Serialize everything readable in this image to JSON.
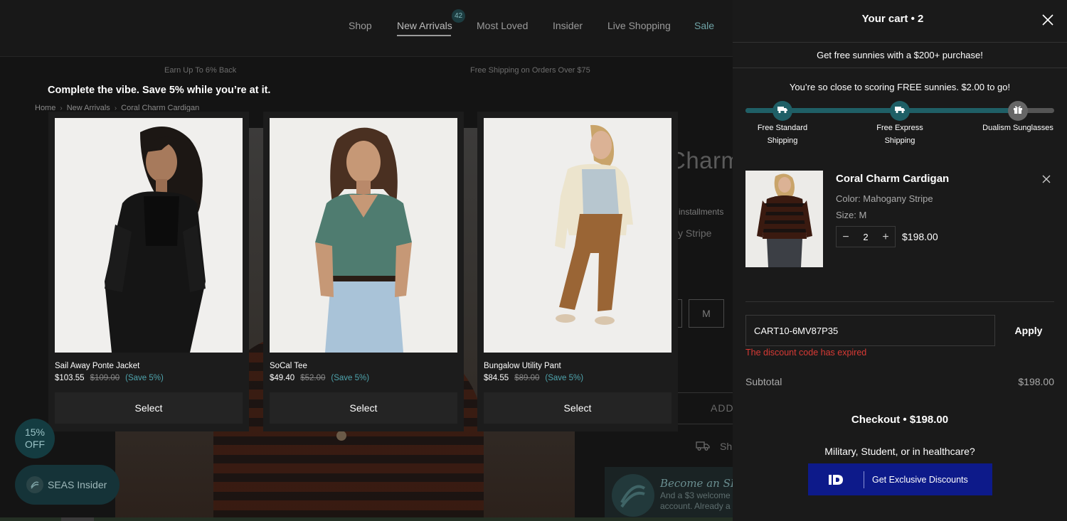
{
  "nav": {
    "items": [
      "Shop",
      "New Arrivals",
      "Most Loved",
      "Insider",
      "Live Shopping",
      "Sale"
    ],
    "new_arrivals_badge": "42"
  },
  "promo": {
    "left": "Earn Up To 6% Back",
    "center": "Free Shipping on Orders Over $75"
  },
  "breadcrumb": [
    "Home",
    "New Arrivals",
    "Coral Charm Cardigan"
  ],
  "upsell": {
    "title": "Complete the vibe. Save 5% while you’re at it.",
    "products": [
      {
        "name": "Sail Away Ponte Jacket",
        "price": "$103.55",
        "compare_price": "$109.00",
        "save": "(Save 5%)",
        "select_label": "Select"
      },
      {
        "name": "SoCal Tee",
        "price": "$49.40",
        "compare_price": "$52.00",
        "save": "(Save 5%)",
        "select_label": "Select"
      },
      {
        "name": "Bungalow Utility Pant",
        "price": "$84.55",
        "compare_price": "$89.00",
        "save": "(Save 5%)",
        "select_label": "Select"
      }
    ]
  },
  "background_product": {
    "title_fragment": "Charm",
    "installments_fragment": "e installments",
    "color_fragment": "y Stripe",
    "size_selected": "M",
    "add_fragment": "ADD",
    "shipping_fragment": "Sh",
    "insider_title_fragment": "Become an SEA",
    "insider_text_1": "And a $3 welcome",
    "insider_text_2": "account. Already a"
  },
  "floating": {
    "discount_badge_line1": "15%",
    "discount_badge_line2": "OFF",
    "insider_label": "SEAS Insider"
  },
  "cart": {
    "title": "Your cart • 2",
    "banner": "Get free sunnies with a $200+ purchase!",
    "progress_message": "You’re so close to scoring FREE sunnies. $2.00 to go!",
    "progress_fraction": 0.88,
    "milestones": [
      {
        "label_line1": "Free Standard",
        "label_line2": "Shipping",
        "reached": true,
        "icon": "truck-icon"
      },
      {
        "label_line1": "Free Express",
        "label_line2": "Shipping",
        "reached": true,
        "icon": "truck-icon"
      },
      {
        "label_line1": "Dualism Sunglasses",
        "label_line2": "",
        "reached": false,
        "icon": "gift-icon"
      }
    ],
    "item": {
      "name": "Coral Charm Cardigan",
      "color": "Color: Mahogany Stripe",
      "size": "Size: M",
      "quantity": "2",
      "price": "$198.00"
    },
    "discount_code": "CART10-6MV87P35",
    "apply_label": "Apply",
    "discount_error": "The discount code has expired",
    "subtotal_label": "Subtotal",
    "subtotal_value": "$198.00",
    "checkout_label": "Checkout • $198.00",
    "military_text": "Military, Student, or in healthcare?",
    "id_button_label": "Get Exclusive Discounts"
  },
  "colors": {
    "accent_teal": "#1f5f66",
    "save_teal": "#4ea4ad",
    "error_red": "#d83a35",
    "id_blue": "#0d1a8a"
  }
}
